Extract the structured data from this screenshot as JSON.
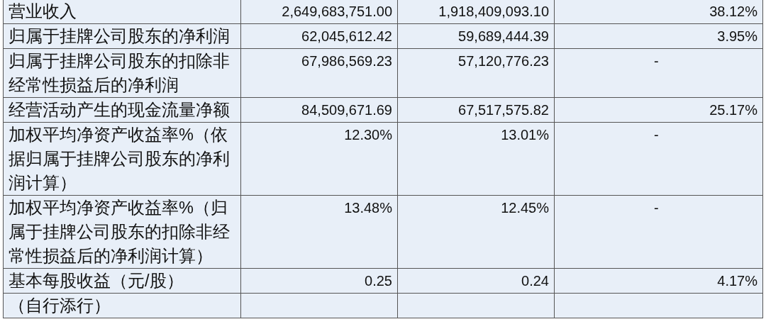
{
  "table": {
    "rows": [
      {
        "label": "营业收入",
        "current": "2,649,683,751.00",
        "previous": "1,918,409,093.10",
        "change": "38.12%"
      },
      {
        "label": "归属于挂牌公司股东的净利润",
        "current": "62,045,612.42",
        "previous": "59,689,444.39",
        "change": "3.95%"
      },
      {
        "label": "归属于挂牌公司股东的扣除非经常性损益后的净利润",
        "current": "67,986,569.23",
        "previous": "57,120,776.23",
        "change": "-"
      },
      {
        "label": "经营活动产生的现金流量净额",
        "current": "84,509,671.69",
        "previous": "67,517,575.82",
        "change": "25.17%"
      },
      {
        "label": "加权平均净资产收益率%（依据归属于挂牌公司股东的净利润计算）",
        "current": "12.30%",
        "previous": "13.01%",
        "change": "-"
      },
      {
        "label": "加权平均净资产收益率%（归属于挂牌公司股东的扣除非经常性损益后的净利润计算）",
        "current": "13.48%",
        "previous": "12.45%",
        "change": "-"
      },
      {
        "label": "基本每股收益（元/股）",
        "current": "0.25",
        "previous": "0.24",
        "change": "4.17%"
      },
      {
        "label": "（自行添行）"
      }
    ]
  }
}
